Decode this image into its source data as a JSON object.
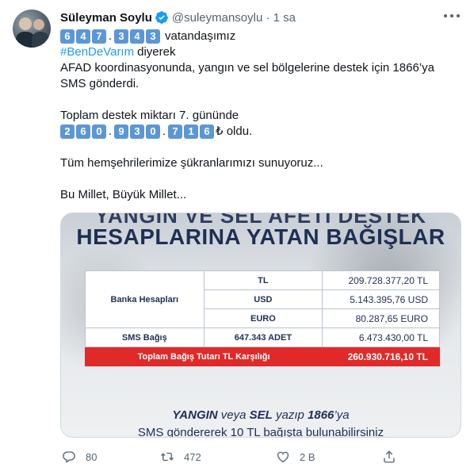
{
  "tweet": {
    "author_name": "Süleyman Soylu",
    "handle_time": "@suleymansoylu · 1 sa",
    "line1_keycaps": [
      "6",
      "4",
      "7",
      ".",
      "3",
      "4",
      "3"
    ],
    "line1_after": "vatandaşımız",
    "hashtag": "#BenDeVarım",
    "hashtag_after": "diyerek",
    "line3": "AFAD koordinasyonunda, yangın ve sel bölgelerine destek için 1866’ya",
    "line4": "SMS gönderdi.",
    "line6": "Toplam destek miktarı 7. gününde",
    "line7_keycaps": [
      "2",
      "6",
      "0",
      ".",
      "9",
      "3",
      "0",
      ".",
      "7",
      "1",
      "6"
    ],
    "line7_after": "₺ oldu.",
    "line9": "Tüm hemşehrilerimize şükranlarımızı sunuyoruz...",
    "line11": "Bu Millet, Büyük Millet..."
  },
  "media": {
    "top_partial": "YANGIN VE SEL AFETI DESTEK",
    "title": "HESAPLARINA YATAN BAĞIŞLAR",
    "bank_label": "Banka Hesapları",
    "rows": [
      {
        "currency": "TL",
        "amount": "209.728.377,20 TL"
      },
      {
        "currency": "USD",
        "amount": "5.143.395,76 USD"
      },
      {
        "currency": "EURO",
        "amount": "80.287,65 EURO"
      }
    ],
    "sms_label": "SMS Bağış",
    "sms_count": "647.343 ADET",
    "sms_amount": "6.473.430,00 TL",
    "total_label": "Toplam Bağış Tutarı TL Karşılığı",
    "total_amount": "260.930.716,10 TL",
    "foot_w1": "YANGIN",
    "foot_w2": " veya ",
    "foot_w3": "SEL",
    "foot_w4": " yazıp ",
    "foot_w5": "1866",
    "foot_w6": "’ya",
    "foot_line2": "SMS göndererek 10 TL bağışta bulunabilirsiniz"
  },
  "actions": {
    "reply_count": "80",
    "retweet_count": "472",
    "like_count": "2 B"
  },
  "colors": {
    "accent": "#1d9bf0",
    "keycap": "#5b97d6",
    "total_row": "#e02a2a",
    "navy": "#1f2f53"
  }
}
